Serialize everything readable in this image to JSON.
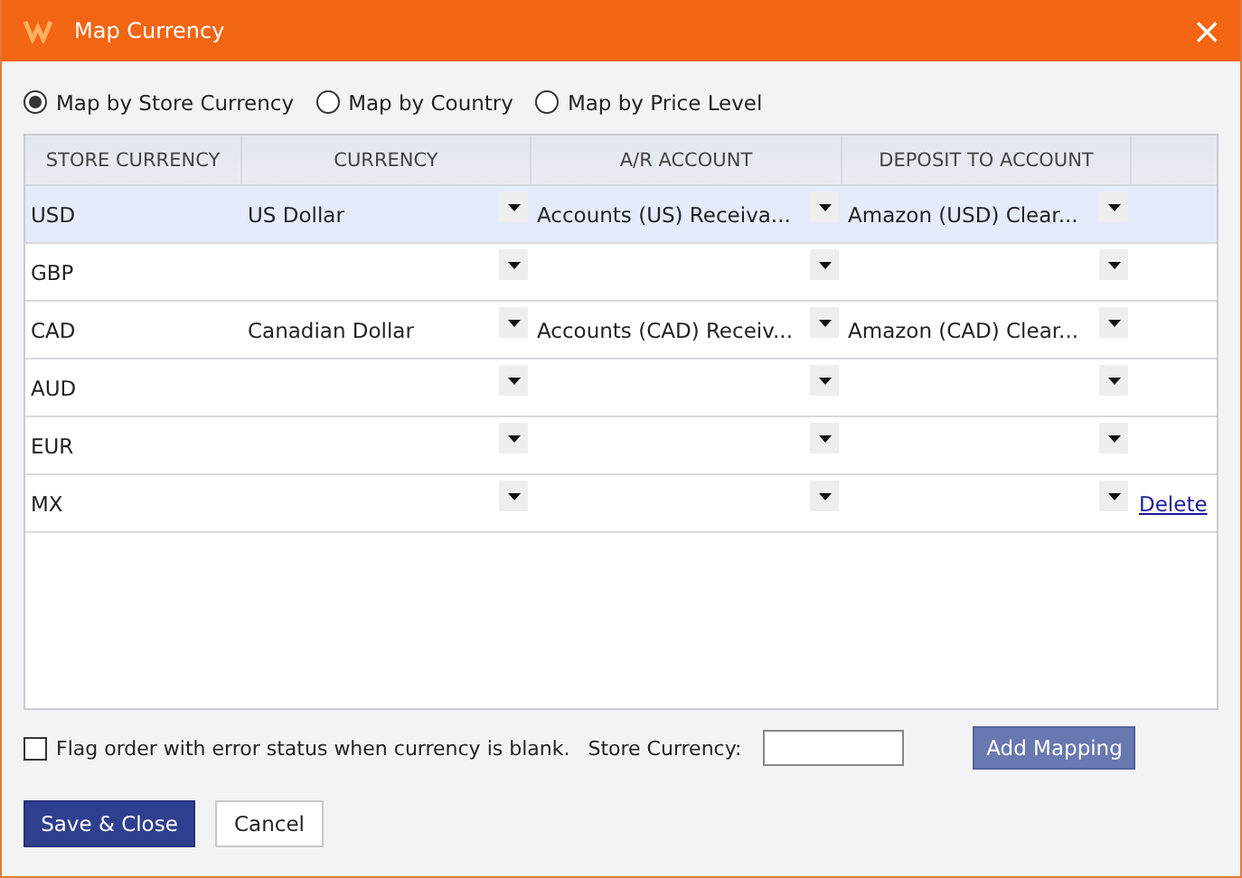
{
  "window": {
    "title": "Map Currency",
    "close": "×"
  },
  "modes": [
    {
      "label": "Map by Store Currency",
      "selected": true
    },
    {
      "label": "Map by Country",
      "selected": false
    },
    {
      "label": "Map by Price Level",
      "selected": false
    }
  ],
  "table": {
    "columns": [
      "STORE CURRENCY",
      "CURRENCY",
      "A/R ACCOUNT",
      "DEPOSIT TO ACCOUNT"
    ],
    "rows": [
      {
        "store": "USD",
        "currency": "US Dollar",
        "ar": "Accounts (US) Receiva...",
        "deposit": "Amazon (USD) Clear...",
        "selected": true
      },
      {
        "store": "GBP",
        "selected": false
      },
      {
        "store": "CAD",
        "currency": "Canadian Dollar",
        "ar": "Accounts (CAD) Receiv...",
        "deposit": "Amazon (CAD) Clear...",
        "selected": false
      },
      {
        "store": "AUD",
        "selected": false
      },
      {
        "store": "EUR",
        "selected": false
      },
      {
        "store": "MX",
        "selected": false,
        "action": "Delete"
      }
    ]
  },
  "flag": {
    "label": "Flag order with error status when currency is blank.",
    "checked": false
  },
  "store_currency": {
    "label": "Store Currency:"
  },
  "buttons": {
    "add": "Add Mapping",
    "save": "Save & Close",
    "cancel": "Cancel"
  }
}
